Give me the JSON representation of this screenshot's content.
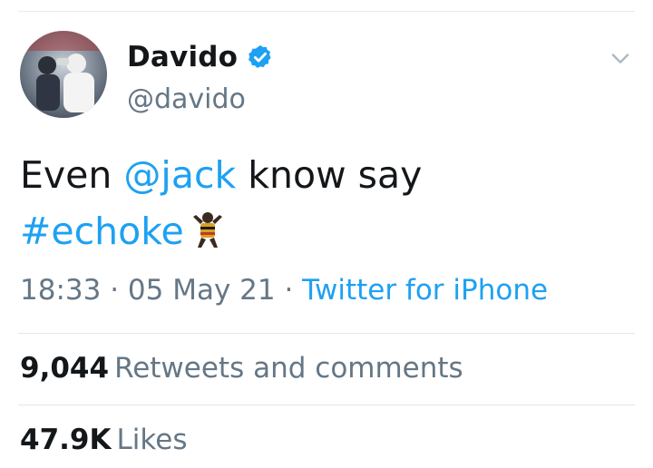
{
  "tweet": {
    "author": {
      "display_name": "Davido",
      "handle": "@davido",
      "verified": true,
      "avatar_icon": "avatar-photo"
    },
    "text": {
      "part1": "Even ",
      "mention": "@jack",
      "part2": " know say",
      "hashtag": "#echoke",
      "emoji": "man-dancing-emoji"
    },
    "meta": {
      "time": "18:33",
      "sep1": " · ",
      "date": "05 May 21",
      "sep2": " · ",
      "source": "Twitter for iPhone"
    },
    "stats": {
      "retweets_count": "9,044",
      "retweets_label": "Retweets and comments",
      "likes_count": "47.9K",
      "likes_label": "Likes"
    }
  },
  "colors": {
    "link": "#1da1f2",
    "text": "#14171a",
    "secondary": "#657786",
    "verified": "#1da1f2",
    "divider": "#e1e8ed"
  }
}
